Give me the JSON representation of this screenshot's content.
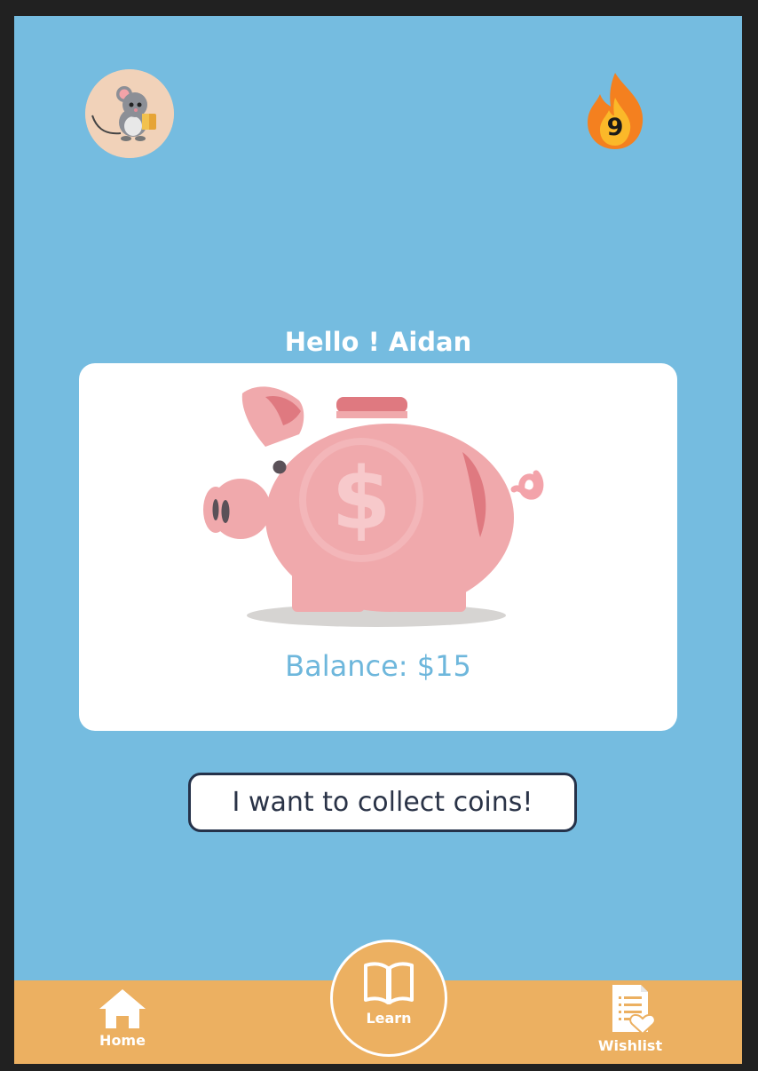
{
  "header": {
    "avatar_icon": "mouse-reading-avatar",
    "streak_icon": "fire-icon",
    "streak_count": "9"
  },
  "main": {
    "greeting": "Hello ! Aidan",
    "piggy_icon": "piggy-bank-dollar",
    "balance": "Balance: $15",
    "collect_button_label": "I want to collect coins!"
  },
  "bottom_nav": {
    "home_label": "Home",
    "learn_label": "Learn",
    "wishlist_label": "Wishlist"
  },
  "colors": {
    "background": "#75bce0",
    "card": "#ffffff",
    "bottom_bar": "#ecb061",
    "piggy": "#f0a9ac",
    "balance_text": "#6eb7dc",
    "button_border": "#25324a"
  }
}
